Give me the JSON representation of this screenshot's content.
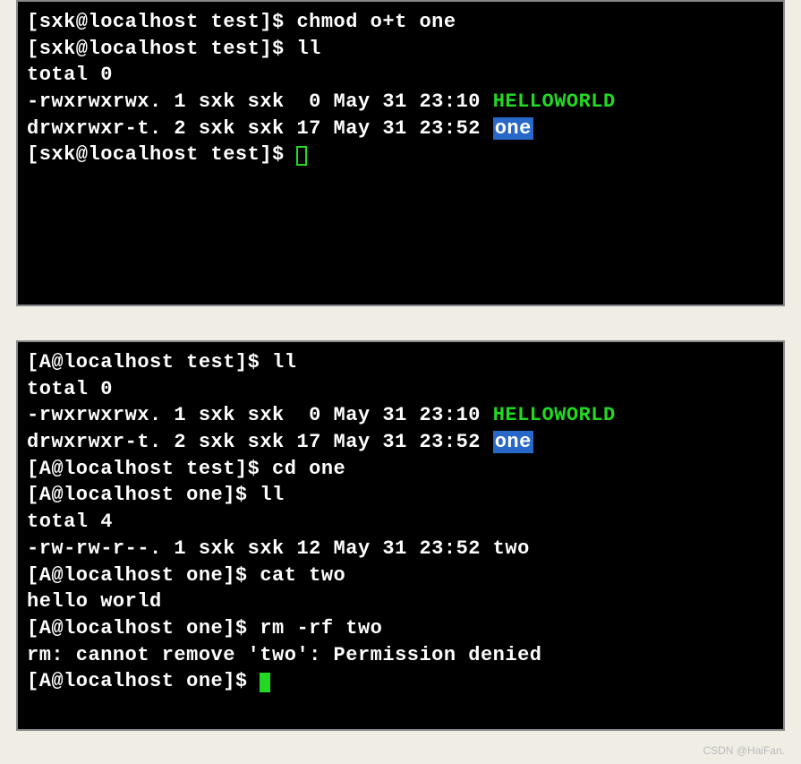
{
  "terminal1": {
    "line1": {
      "prompt": "[sxk@localhost test]$ ",
      "cmd": "chmod o+t one"
    },
    "line2": {
      "prompt": "[sxk@localhost test]$ ",
      "cmd": "ll"
    },
    "line3": "total 0",
    "line4": {
      "perms": "-rwxrwxrwx. 1 sxk sxk  0 May 31 23:10 ",
      "file": "HELLOWORLD"
    },
    "line5": {
      "perms": "drwxrwxr-t. 2 sxk sxk 17 May 31 23:52 ",
      "file": "one"
    },
    "line6": {
      "prompt": "[sxk@localhost test]$ "
    }
  },
  "terminal2": {
    "line1": {
      "prompt": "[A@localhost test]$ ",
      "cmd": "ll"
    },
    "line2": "total 0",
    "line3": {
      "perms": "-rwxrwxrwx. 1 sxk sxk  0 May 31 23:10 ",
      "file": "HELLOWORLD"
    },
    "line4": {
      "perms": "drwxrwxr-t. 2 sxk sxk 17 May 31 23:52 ",
      "file": "one"
    },
    "line5": {
      "prompt": "[A@localhost test]$ ",
      "cmd": "cd one"
    },
    "line6": {
      "prompt": "[A@localhost one]$ ",
      "cmd": "ll"
    },
    "line7": "total 4",
    "line8": "-rw-rw-r--. 1 sxk sxk 12 May 31 23:52 two",
    "line9": {
      "prompt": "[A@localhost one]$ ",
      "cmd": "cat two"
    },
    "line10": "hello world",
    "line11": {
      "prompt": "[A@localhost one]$ ",
      "cmd": "rm -rf two"
    },
    "line12": "rm: cannot remove 'two': Permission denied",
    "line13": {
      "prompt": "[A@localhost one]$ "
    }
  },
  "watermark": "CSDN @HaiFan."
}
